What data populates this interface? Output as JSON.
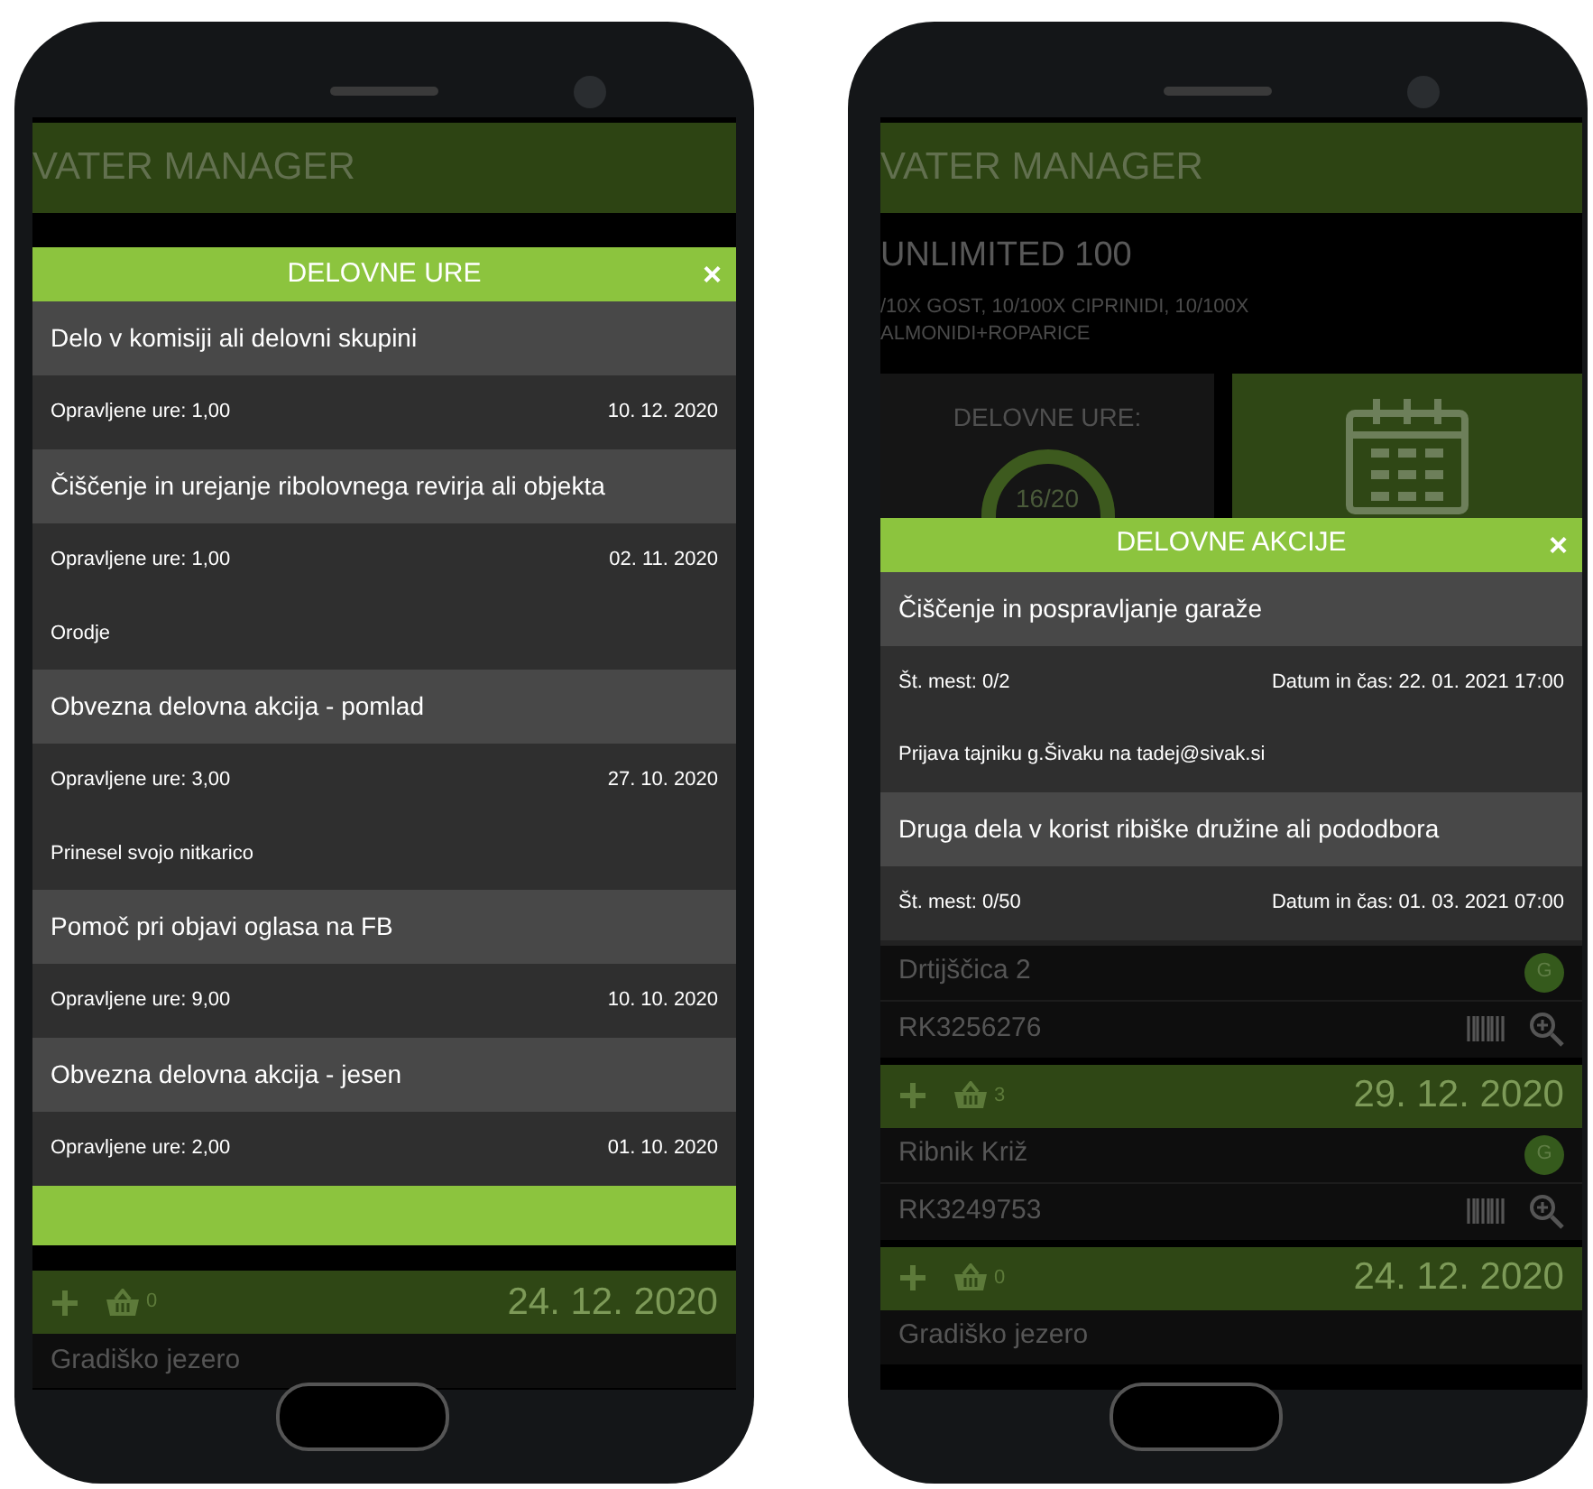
{
  "phones": [
    {
      "app_title": "VATER MANAGER",
      "dialog": {
        "title": "DELOVNE URE",
        "close": "×",
        "footer": true,
        "items": [
          {
            "title": "Delo v komisiji ali delovni skupini",
            "left": "Opravljene ure: 1,00",
            "right": "10. 12. 2020"
          },
          {
            "title": "Čiščenje in urejanje ribolovnega revirja ali objekta",
            "left": "Opravljene ure: 1,00",
            "right": "02. 11. 2020",
            "note": "Orodje"
          },
          {
            "title": "Obvezna delovna akcija - pomlad",
            "left": "Opravljene ure: 3,00",
            "right": "27. 10. 2020",
            "note": "Prinesel svojo nitkarico"
          },
          {
            "title": "Pomoč pri objavi oglasa na FB",
            "left": "Opravljene ure: 9,00",
            "right": "10. 10. 2020"
          },
          {
            "title": "Obvezna delovna akcija - jesen",
            "left": "Opravljene ure: 2,00",
            "right": "01. 10. 2020"
          }
        ]
      },
      "list": [
        {
          "kind": "bar",
          "count": "0",
          "date": "24. 12. 2020"
        },
        {
          "kind": "permit",
          "name": "Gradiško jezero"
        }
      ]
    },
    {
      "app_title": "VATER MANAGER",
      "subscription": {
        "title": "UNLIMITED 100",
        "description": [
          "/10X GOST, 10/100X CIPRINIDI, 10/100X",
          "ALMONIDI+ROPARICE"
        ]
      },
      "summary": {
        "hours_label": "DELOVNE URE:",
        "hours_value": "16/20"
      },
      "dialog": {
        "title": "DELOVNE AKCIJE",
        "close": "×",
        "footer": false,
        "items": [
          {
            "title": "Čiščenje in pospravljanje garaže",
            "left": "Št. mest: 0/2",
            "right": "Datum in čas: 22. 01. 2021 17:00",
            "note": "Prijava tajniku g.Šivaku na tadej@sivak.si"
          },
          {
            "title": "Druga dela v korist ribiške družine ali pododbora",
            "left": "Št. mest: 0/50",
            "right": "Datum in čas: 01. 03. 2021 07:00"
          }
        ]
      },
      "list": [
        {
          "kind": "permit",
          "name": "Drtijščica 2",
          "badge": "G",
          "code": "RK3256276"
        },
        {
          "kind": "bar",
          "count": "3",
          "date": "29. 12. 2020"
        },
        {
          "kind": "permit",
          "name": "Ribnik Križ",
          "badge": "G",
          "code": "RK3249753"
        },
        {
          "kind": "bar",
          "count": "0",
          "date": "24. 12. 2020"
        },
        {
          "kind": "permit",
          "name": "Gradiško jezero"
        }
      ]
    }
  ]
}
